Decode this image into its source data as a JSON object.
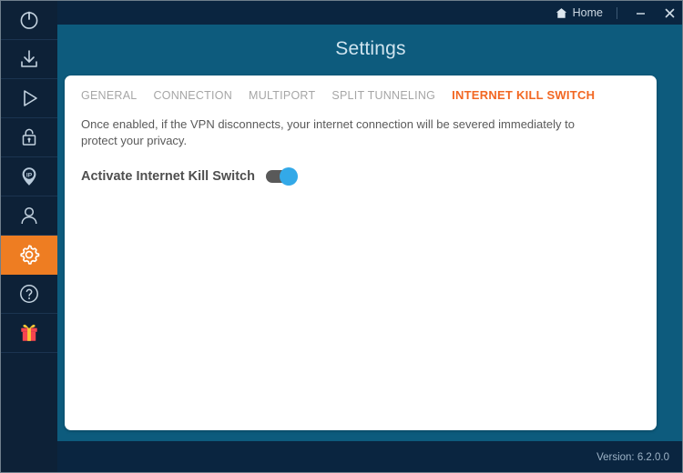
{
  "window": {
    "title": "Settings",
    "version_text": "Version: 6.2.0.0"
  },
  "topbar": {
    "home_label": "Home",
    "home_icon": "home-icon",
    "minimize_icon": "minimize-icon",
    "close_icon": "close-icon"
  },
  "sidebar": {
    "active_index": 6,
    "items": [
      {
        "name": "power",
        "icon": "power-icon"
      },
      {
        "name": "download",
        "icon": "download-icon"
      },
      {
        "name": "play",
        "icon": "play-icon"
      },
      {
        "name": "lock",
        "icon": "lock-icon"
      },
      {
        "name": "ip",
        "icon": "ip-pin-icon",
        "label": "IP"
      },
      {
        "name": "account",
        "icon": "user-icon"
      },
      {
        "name": "settings",
        "icon": "gear-icon"
      },
      {
        "name": "help",
        "icon": "question-mark-icon"
      },
      {
        "name": "gift",
        "icon": "gift-icon"
      }
    ]
  },
  "main": {
    "tabs": [
      {
        "label": "GENERAL",
        "active": false
      },
      {
        "label": "CONNECTION",
        "active": false
      },
      {
        "label": "MULTIPORT",
        "active": false
      },
      {
        "label": "SPLIT TUNNELING",
        "active": false
      },
      {
        "label": "INTERNET KILL SWITCH",
        "active": true
      }
    ],
    "description": "Once enabled, if the VPN disconnects, your internet connection will be severed immediately to protect your privacy.",
    "toggle": {
      "label": "Activate Internet Kill Switch",
      "state": "on"
    }
  },
  "colors": {
    "accent_orange": "#f26722",
    "sidebar_active": "#ee7d22",
    "toggle_on": "#33a9e8",
    "toggle_track": "#595959",
    "teal": "#0d5b7d",
    "navy": "#0a2540"
  }
}
